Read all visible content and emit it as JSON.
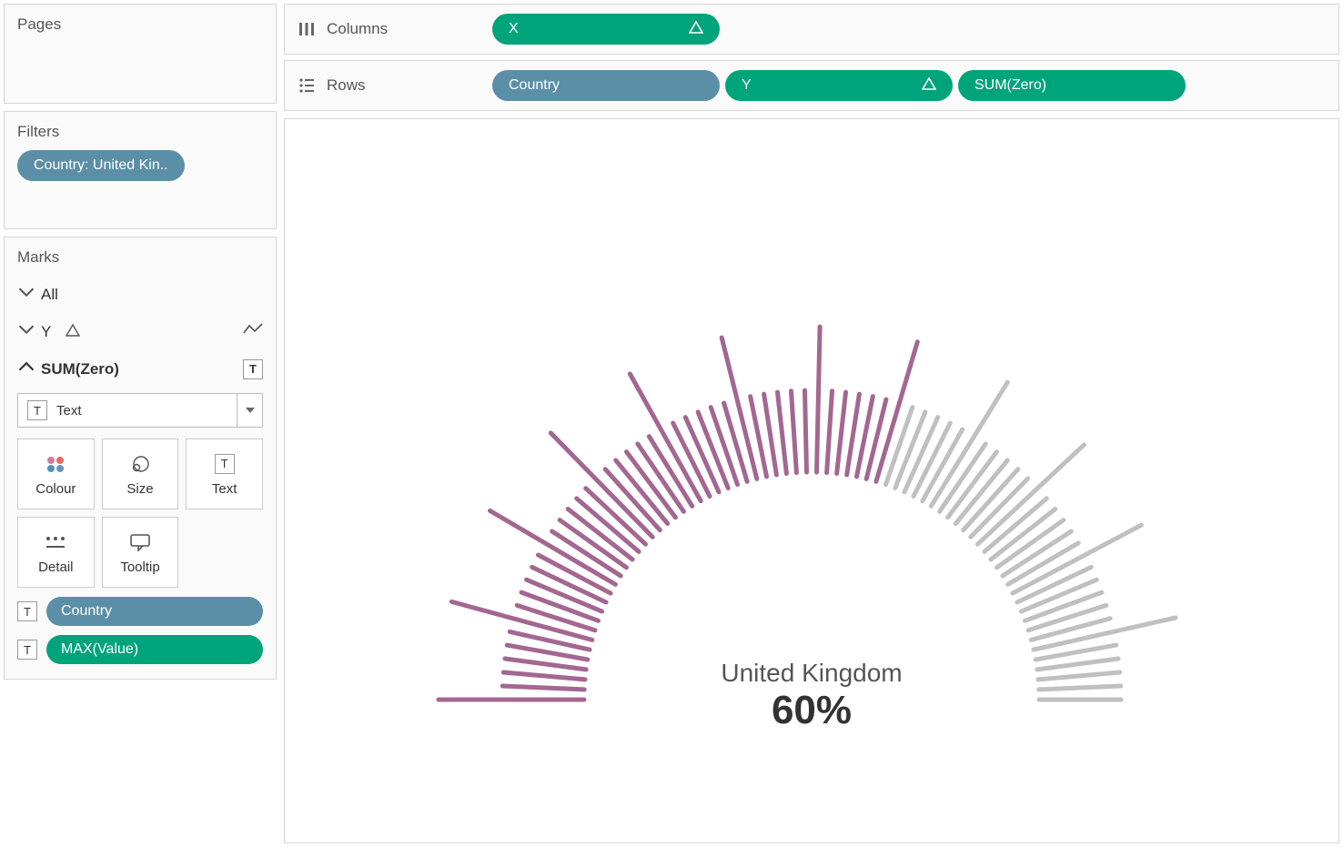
{
  "pages": {
    "title": "Pages"
  },
  "filters": {
    "title": "Filters",
    "items": [
      {
        "label": "Country: United Kin.."
      }
    ]
  },
  "shelves": {
    "columns": {
      "label": "Columns",
      "pills": [
        {
          "label": "X",
          "color": "green",
          "delta": true
        }
      ]
    },
    "rows": {
      "label": "Rows",
      "pills": [
        {
          "label": "Country",
          "color": "blue"
        },
        {
          "label": "Y",
          "color": "green",
          "delta": true
        },
        {
          "label": "SUM(Zero)",
          "color": "green"
        }
      ]
    }
  },
  "marks": {
    "title": "Marks",
    "expand_all": "All",
    "y_row": "Y",
    "sum_zero": "SUM(Zero)",
    "text_type": "Text",
    "buttons": {
      "colour": "Colour",
      "size": "Size",
      "text": "Text",
      "detail": "Detail",
      "tooltip": "Tooltip"
    },
    "fields": [
      {
        "label": "Country",
        "color": "blue"
      },
      {
        "label": "MAX(Value)",
        "color": "green"
      }
    ]
  },
  "chart_data": {
    "type": "gauge",
    "country": "United Kingdom",
    "value_label": "60%",
    "value": 60,
    "total_ticks": 72,
    "long_tick_every": 6,
    "angle_start_deg": 180,
    "angle_end_deg": 0,
    "inner_radius_short": 250,
    "outer_radius_short": 340,
    "inner_radius_long": 250,
    "outer_radius_long": 410,
    "colors": {
      "filled": "#a36791",
      "empty": "#c0c0c0"
    }
  }
}
